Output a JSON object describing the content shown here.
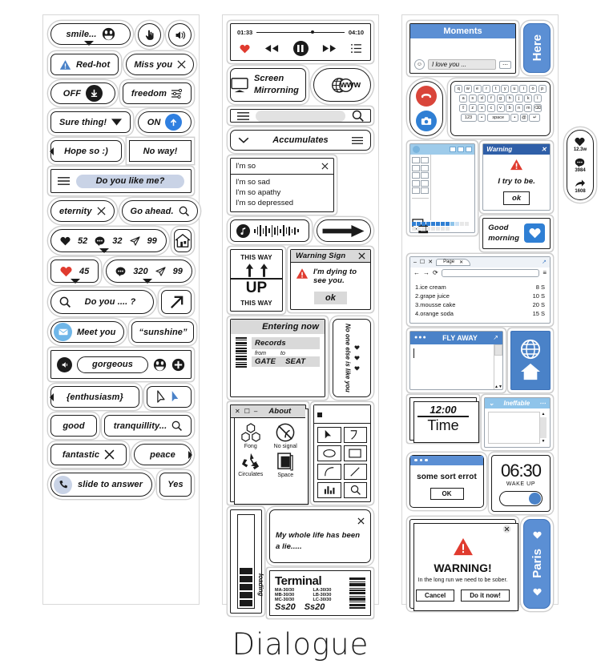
{
  "title": "Dialogue",
  "col1": {
    "smile": "smile...",
    "red_hot": "Red-hot",
    "miss_you": "Miss you",
    "off": "OFF",
    "freedom": "freedom",
    "sure_thing": "Sure thing!",
    "on": "ON",
    "hope_so": "Hope so :)",
    "no_way": "No way!",
    "do_you_like_me": "Do you like me?",
    "eternity": "eternity",
    "go_ahead": "Go ahead.",
    "stats1": {
      "likes": "52",
      "comments": "32",
      "shares": "99"
    },
    "stats2": {
      "likes": "45"
    },
    "stats3": {
      "comments": "320",
      "shares": "99"
    },
    "do_you": "Do you .... ?",
    "meet_you": "Meet you",
    "sunshine": "“sunshine”",
    "gorgeous": "gorgeous",
    "enthusiasm": "{enthusiasm}",
    "good": "good",
    "tranquillity": "tranquillity...",
    "fantastic": "fantastic",
    "peace": "peace",
    "slide_to_answer": "slide to answer",
    "yes": "Yes"
  },
  "col2": {
    "player": {
      "elapsed": "01:33",
      "total": "04:10"
    },
    "screen_mirroring": "Screen Mirrorning",
    "www": "www",
    "accumulates": "Accumulates",
    "social": {
      "likes": "12.3w",
      "comments": "3984",
      "shares": "1608"
    },
    "dropdown": {
      "value": "I'm so",
      "options": [
        "I'm so sad",
        "I'm so apathy",
        "I'm so depressed"
      ]
    },
    "this_way": {
      "top": "THIS WAY",
      "mid": "UP",
      "bottom": "THIS WAY"
    },
    "warning_sign": {
      "title": "Warning Sign",
      "body": "I'm dying to see you.",
      "ok": "ok"
    },
    "ticket": {
      "header": "Entering now",
      "records": "Records",
      "from": "from",
      "to": "to",
      "gate": "GATE",
      "seat": "SEAT"
    },
    "no_one": "No one else is like you",
    "about": {
      "title": "About",
      "items": [
        "Fong",
        "No signal",
        "Circulates",
        "Space"
      ]
    },
    "loading": "loading",
    "my_whole_life": "My whole life has been a lie.....",
    "terminal": {
      "title": "Terminal",
      "codes": [
        "MA-30/30",
        "LA-30/30",
        "MB-30/30",
        "LB-30/30",
        "MC-30/30",
        "LC-30/30"
      ],
      "ss_left": "Ss20",
      "ss_right": "Ss20"
    }
  },
  "col3": {
    "moments": {
      "title": "Moments",
      "input": "I love you ..."
    },
    "here": "Here",
    "keyboard": {
      "row1": [
        "q",
        "w",
        "e",
        "r",
        "t",
        "y",
        "u",
        "i",
        "o",
        "p"
      ],
      "row2": [
        "a",
        "s",
        "d",
        "f",
        "g",
        "h",
        "j",
        "k",
        "l"
      ],
      "row3": [
        "⇧",
        "z",
        "x",
        "c",
        "v",
        "b",
        "n",
        "m",
        "⌫"
      ],
      "row4": [
        "123",
        "•",
        "space",
        "•",
        "@",
        "↵"
      ]
    },
    "warning_small": {
      "title": "Warning",
      "body": "I try to be.",
      "ok": "ok"
    },
    "good_morning": "Good\nmorning",
    "browser": {
      "tab": "Page",
      "items": [
        {
          "name": "1.ice cream",
          "price": "8 S"
        },
        {
          "name": "2.grape juice",
          "price": "10 S"
        },
        {
          "name": "3.mousse cake",
          "price": "20 S"
        },
        {
          "name": "4.orange soda",
          "price": "15 S"
        }
      ]
    },
    "fly_away": "FLY AWAY",
    "clock": {
      "time": "12:00",
      "label": "Time"
    },
    "ineffable": "Ineffable",
    "error": {
      "body": "some sort errot",
      "ok": "OK"
    },
    "alarm": {
      "time": "06:30",
      "label": "WAKE UP"
    },
    "warning_big": {
      "title": "WARNING!",
      "body": "In the long run we need to be sober.",
      "cancel": "Cancel",
      "confirm": "Do it now!"
    },
    "paris": "Paris"
  },
  "colors": {
    "blue": "#5b8fd4",
    "deep_blue": "#2f5fa8",
    "red": "#e03b2f",
    "accent": "#2f7fe0"
  }
}
